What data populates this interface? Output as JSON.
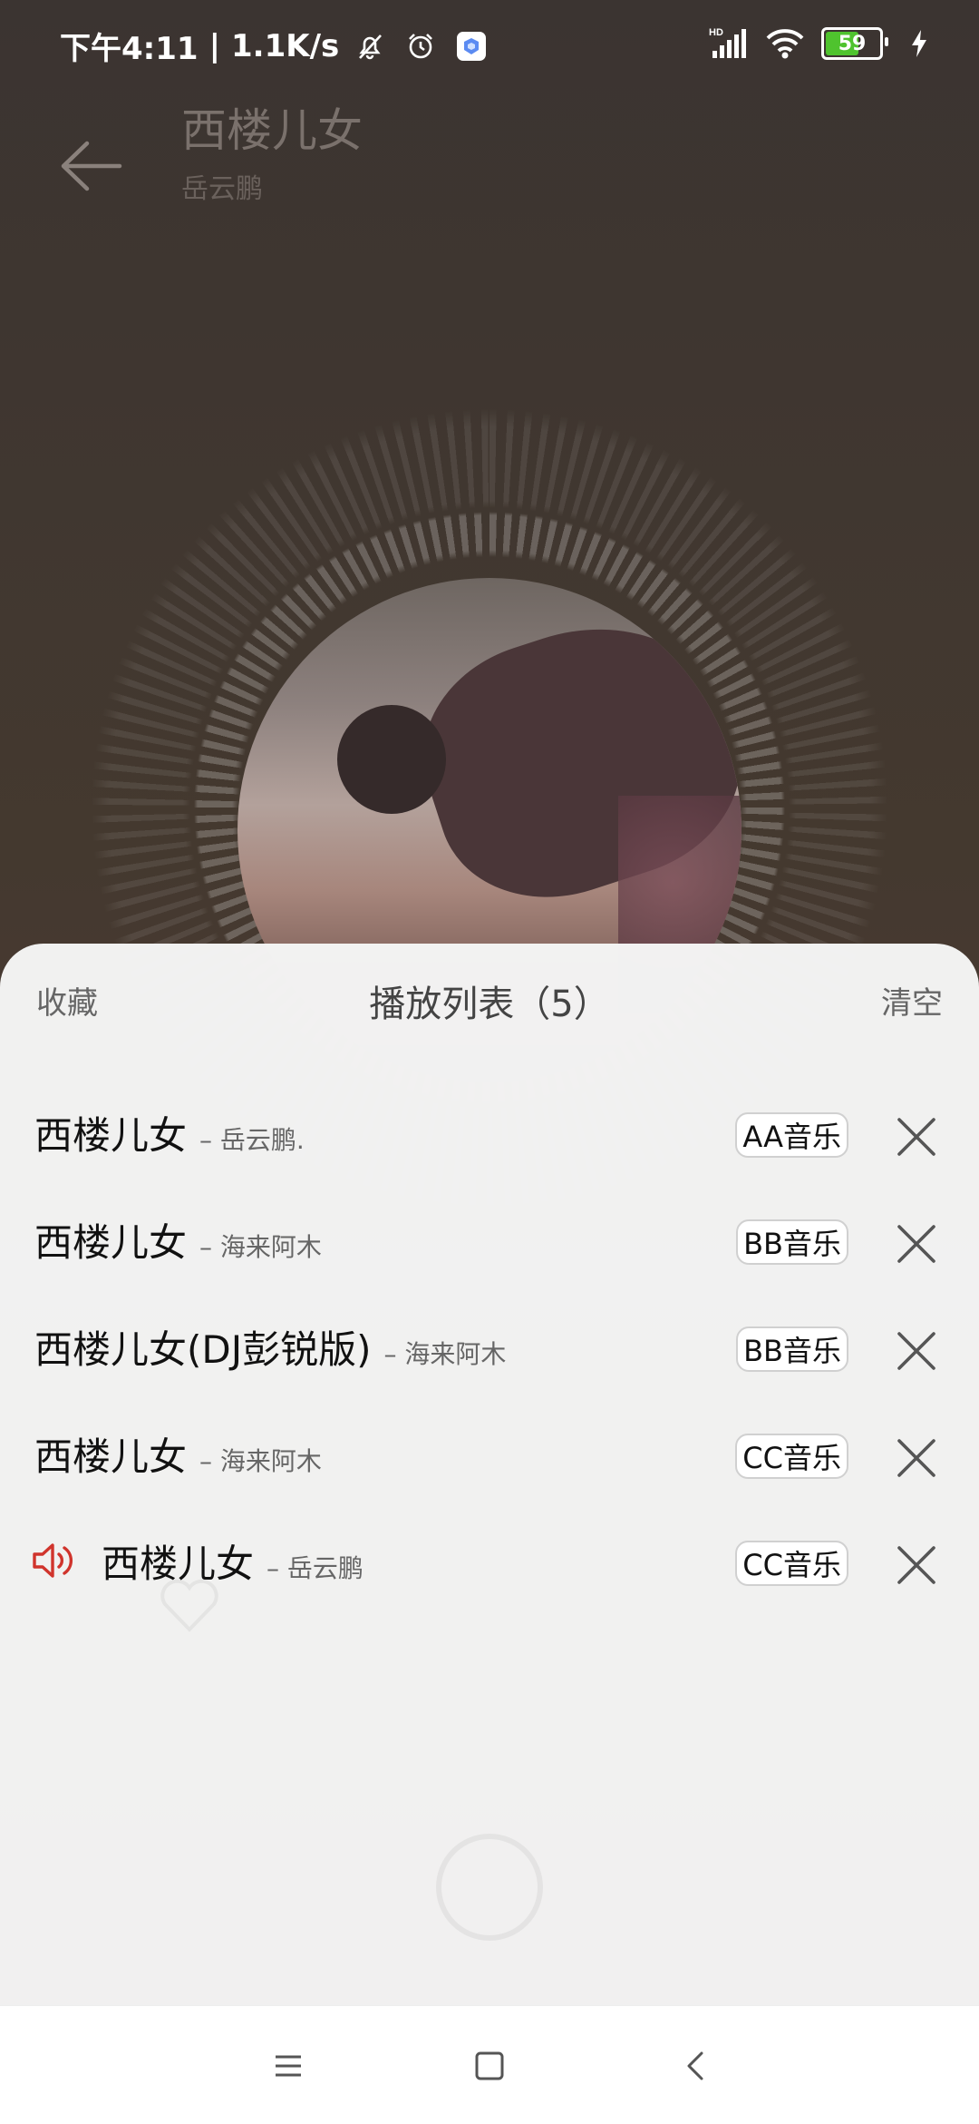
{
  "status_bar": {
    "time": "下午4:11",
    "speed": "1.1K/s",
    "battery": "59",
    "network": "HD"
  },
  "header": {
    "title": "西楼儿女",
    "artist": "岳云鹏"
  },
  "sheet": {
    "favorite_label": "收藏",
    "title": "播放列表（5）",
    "clear_label": "清空"
  },
  "playlist": [
    {
      "title": "西楼儿女",
      "artist": "– 岳云鹏.",
      "source": "AA音乐",
      "playing": false
    },
    {
      "title": "西楼儿女",
      "artist": "– 海来阿木",
      "source": "BB音乐",
      "playing": false
    },
    {
      "title": "西楼儿女(DJ彭锐版)",
      "artist": "– 海来阿木",
      "source": "BB音乐",
      "playing": false
    },
    {
      "title": "西楼儿女",
      "artist": "– 海来阿木",
      "source": "CC音乐",
      "playing": false
    },
    {
      "title": "西楼儿女",
      "artist": "– 岳云鹏",
      "source": "CC音乐",
      "playing": true
    }
  ],
  "colors": {
    "playing_icon": "#d0342c",
    "battery_fill": "#4fc32e"
  }
}
